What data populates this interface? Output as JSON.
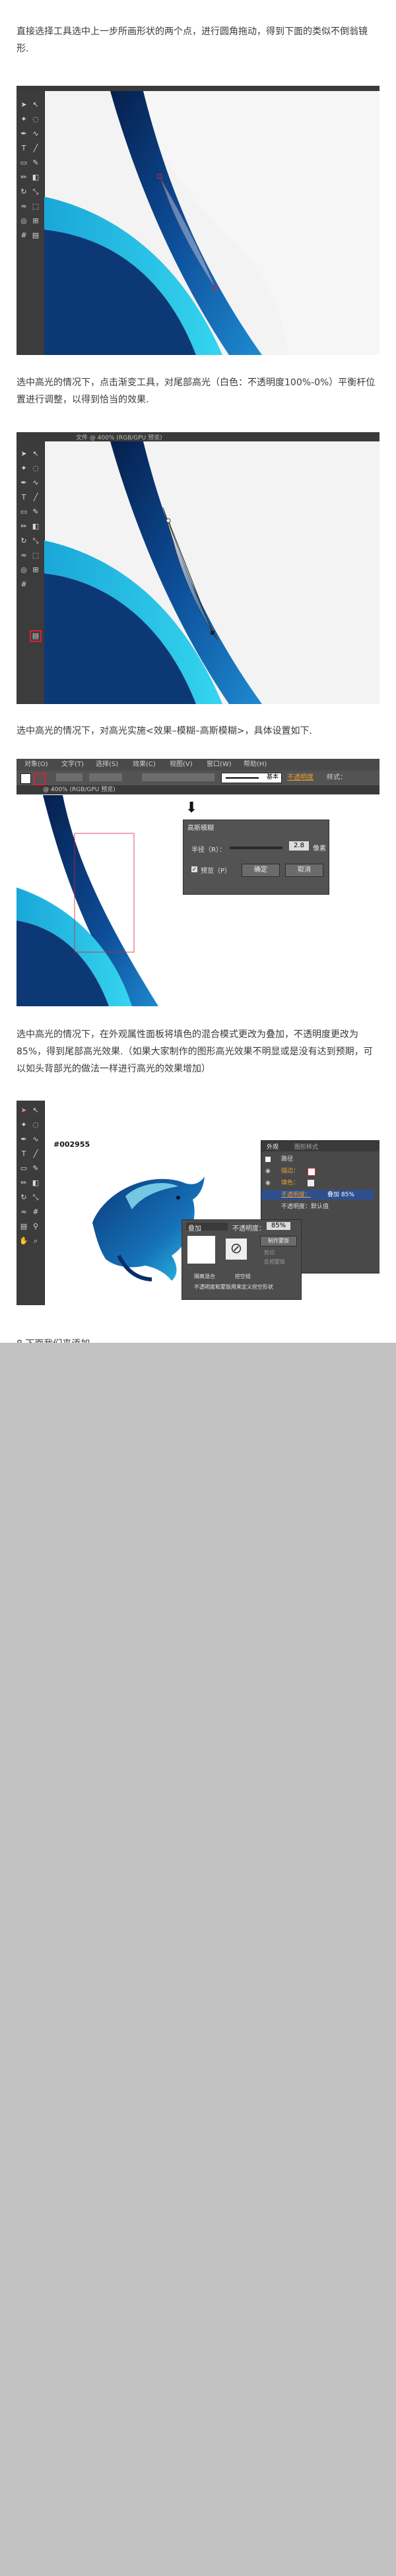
{
  "paragraphs": {
    "p1": "直接选择工具选中上一步所画形状的两个点，进行圆角拖动，得到下面的类似不倒翁镜形.",
    "p2": "选中高光的情况下，点击渐变工具，对尾部高光（白色：不透明度100%-0%）平衡杆位置进行调整，以得到恰当的效果.",
    "p3": "选中高光的情况下，对高光实施<效果–模糊–高斯模糊>，具体设置如下.",
    "p4": "选中高光的情况下，在外观属性面板将填色的混合模式更改为叠加，不透明度更改为85%，得到尾部高光效果.（如果大家制作的图形高光效果不明显或是没有达到预期，可以如头背部光的做法一样进行高光的效果增加）",
    "p5": "8.下面我们来添加"
  },
  "shot2": {
    "titlebar": "文件 @ 400% (RGB/GPU 预览)"
  },
  "shot3": {
    "menu": [
      "对象(O)",
      "文字(T)",
      "选择(S)",
      "效果(C)",
      "视图(V)",
      "窗口(W)",
      "帮助(H)"
    ],
    "tab": "@ 400% (RGB/GPU 预览)",
    "opacity_label": "不透明度",
    "style_label": "样式：",
    "stroke_label": "基本",
    "dialog": {
      "title": "高斯模糊",
      "radius_label": "半径（R）：",
      "radius_value": "2.8",
      "radius_unit": "像素",
      "preview_label": "预览（P）",
      "ok": "确定",
      "cancel": "取消"
    }
  },
  "shot4": {
    "color_code": "#002955",
    "panel": {
      "title": "外观",
      "tab2": "图形样式",
      "rows": [
        "路径",
        "描边：",
        "填色：",
        "不透明度：",
        "叠加 85%",
        "不透明度：默认值"
      ]
    },
    "blend_menu": {
      "mode": "叠加",
      "opacity_label": "不透明度：",
      "opacity_value": "85%",
      "make_mask": "制作蒙版",
      "clip": "剪切",
      "invert": "反相蒙版",
      "isolate": "隔离混合",
      "knockout": "挖空组",
      "opacity_mask": "不透明度和蒙版用来定义挖空形状"
    }
  },
  "colors": {
    "dolphin_dark": "#0a2d66",
    "dolphin_mid": "#1670b8",
    "dolphin_light": "#2bc8e8",
    "accent_red": "#d8213a"
  }
}
